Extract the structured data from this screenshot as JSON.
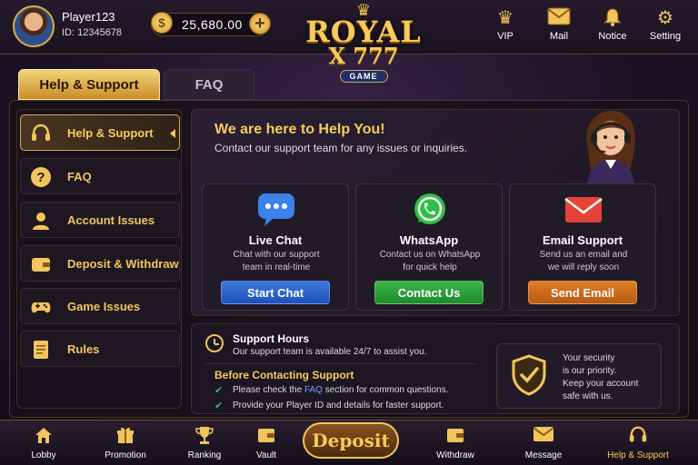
{
  "header": {
    "player_name": "Player123",
    "player_id": "ID: 12345678",
    "coin_balance": "25,680.00",
    "coin_symbol": "$",
    "add_symbol": "+",
    "logo": {
      "line1": "ROYAL",
      "line2": "X 777",
      "badge": "GAME"
    },
    "nav": [
      {
        "label": "VIP",
        "icon": "crown-icon"
      },
      {
        "label": "Mail",
        "icon": "mail-icon"
      },
      {
        "label": "Notice",
        "icon": "bell-icon"
      },
      {
        "label": "Setting",
        "icon": "gear-icon"
      }
    ]
  },
  "tabs": [
    {
      "label": "Help & Support",
      "active": true
    },
    {
      "label": "FAQ",
      "active": false
    }
  ],
  "sidebar": {
    "items": [
      {
        "label": "Help & Support",
        "icon": "headset-icon",
        "active": true
      },
      {
        "label": "FAQ",
        "icon": "question-icon"
      },
      {
        "label": "Account Issues",
        "icon": "user-icon"
      },
      {
        "label": "Deposit & Withdraw",
        "icon": "wallet-icon"
      },
      {
        "label": "Game Issues",
        "icon": "gamepad-icon"
      },
      {
        "label": "Rules",
        "icon": "document-icon"
      }
    ]
  },
  "hero": {
    "title": "We are here to Help You!",
    "subtitle": "Contact our support team for any issues or inquiries."
  },
  "cards": [
    {
      "title": "Live Chat",
      "desc1": "Chat with our support",
      "desc2": "team in real-time",
      "button": "Start Chat",
      "icon": "chat-bubble-icon",
      "color": "#3d79e0"
    },
    {
      "title": "WhatsApp",
      "desc1": "Contact us on WhatsApp",
      "desc2": "for quick help",
      "button": "Contact Us",
      "icon": "whatsapp-icon",
      "color": "#3bb54a"
    },
    {
      "title": "Email Support",
      "desc1": "Send us an email and",
      "desc2": "we will reply soon",
      "button": "Send Email",
      "icon": "envelope-icon",
      "color": "#e07d26"
    }
  ],
  "support_hours": {
    "title": "Support Hours",
    "text": "Our support team is available 24/7 to assist you."
  },
  "before_contacting": {
    "title": "Before Contacting Support",
    "tip1_pre": "Please check the ",
    "tip1_link": "FAQ",
    "tip1_post": " section for common questions.",
    "tip2": "Provide your Player ID and details for faster support."
  },
  "security": {
    "line1": "Your security",
    "line2": "is our priority.",
    "line3": "Keep your account",
    "line4": "safe with us."
  },
  "bottom_nav": [
    {
      "label": "Lobby",
      "icon": "home-icon"
    },
    {
      "label": "Promotion",
      "icon": "gift-icon"
    },
    {
      "label": "Ranking",
      "icon": "trophy-icon"
    },
    {
      "label": "Vault",
      "icon": "vault-icon"
    },
    {
      "label": "Deposit",
      "icon": "deposit-button"
    },
    {
      "label": "Withdraw",
      "icon": "withdraw-icon"
    },
    {
      "label": "Message",
      "icon": "message-icon"
    },
    {
      "label": "Help & Support",
      "icon": "headset-icon",
      "active": true
    }
  ],
  "colors": {
    "accent": "#f2c55c",
    "background": "#1c1226",
    "live_chat": "#3d79e0",
    "whatsapp": "#3bb54a",
    "email": "#e07d26"
  }
}
